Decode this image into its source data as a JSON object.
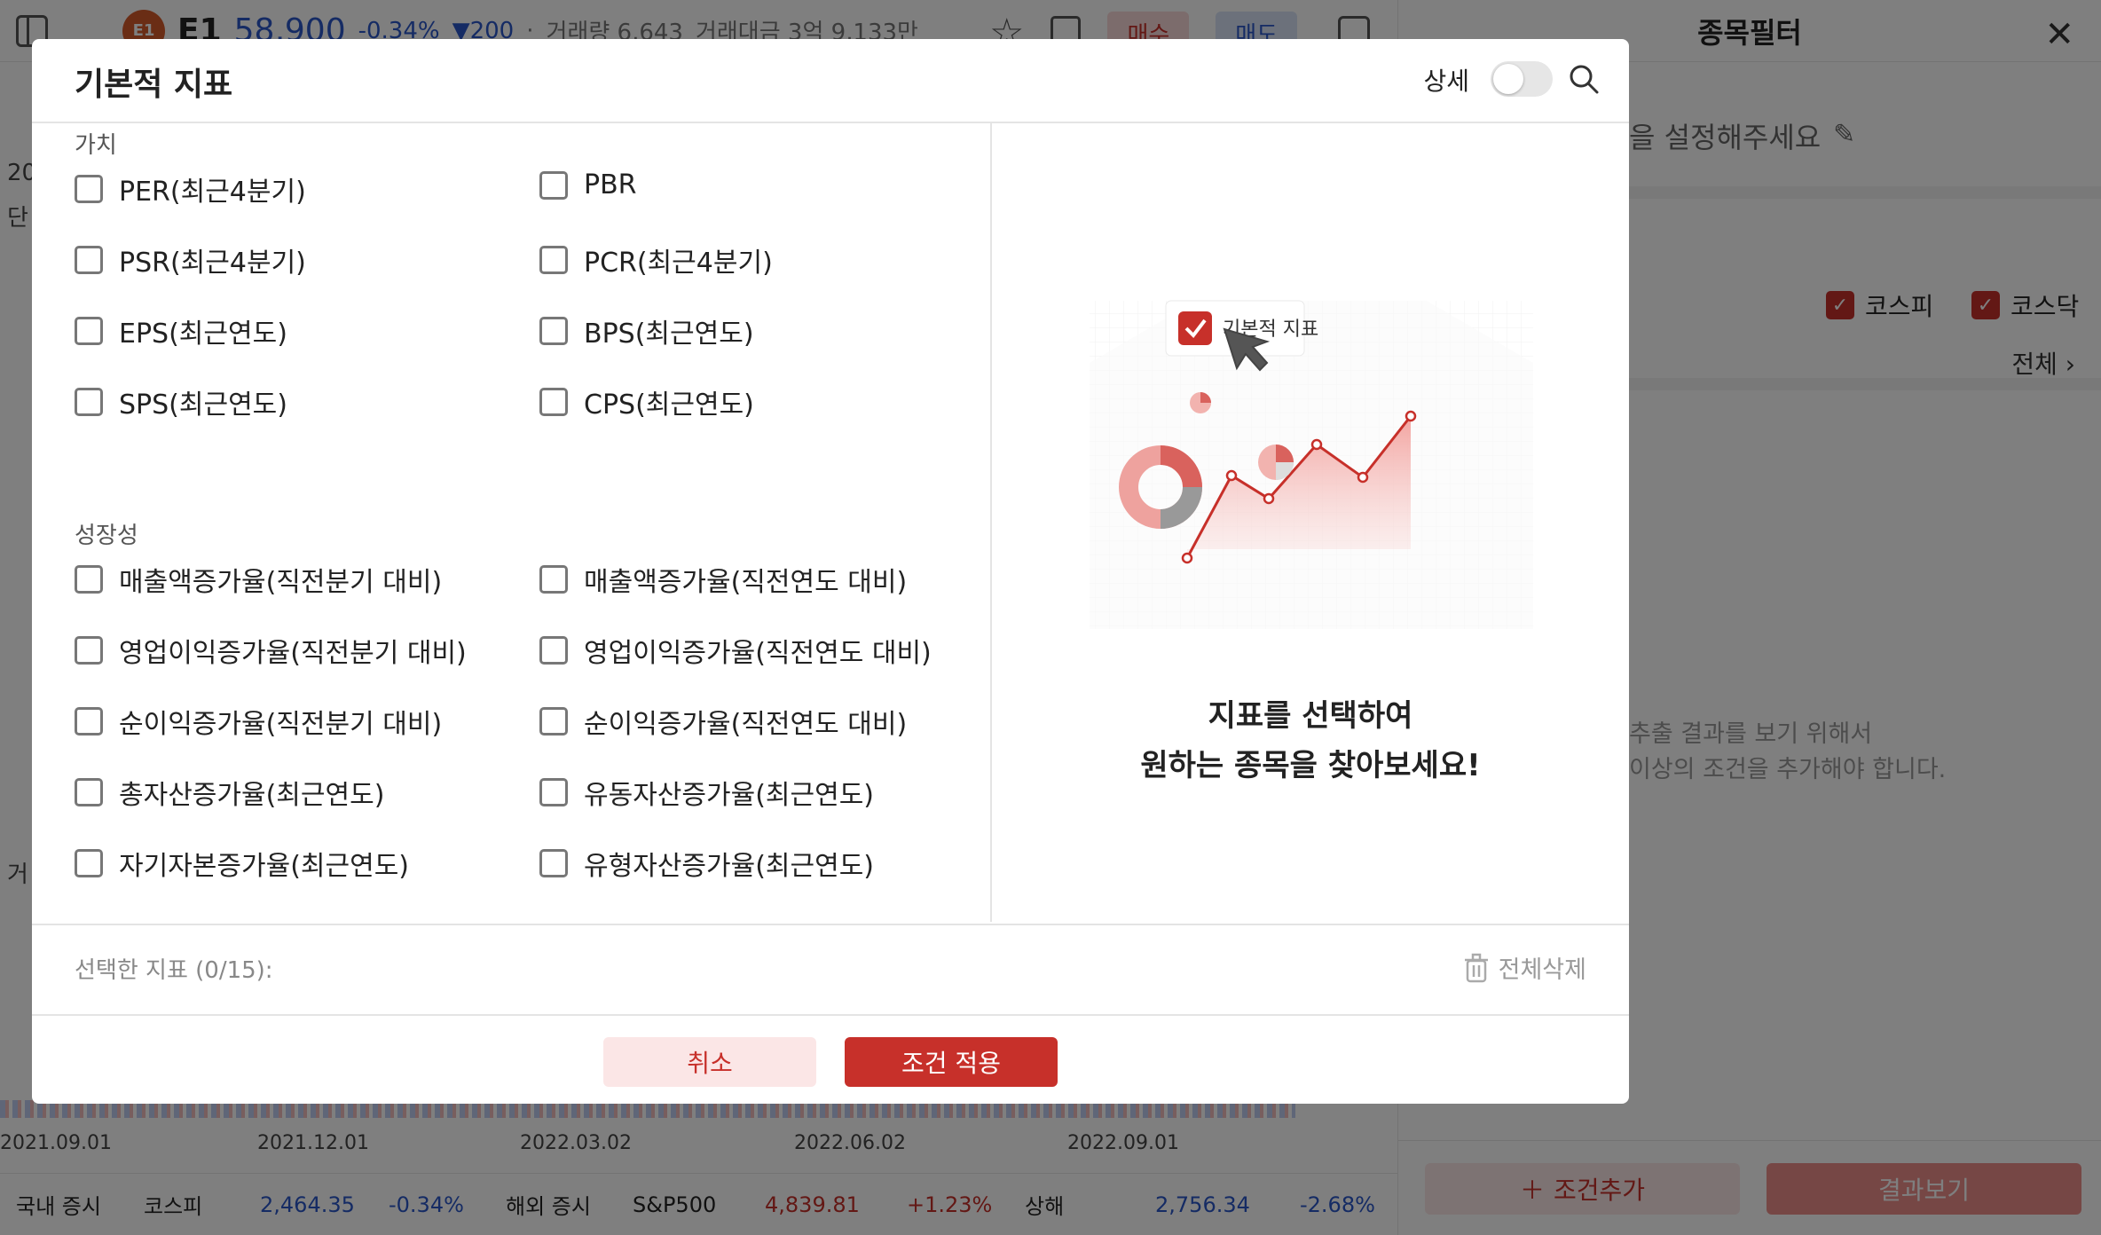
{
  "stock": {
    "logo_text": "E1",
    "symbol": "E1",
    "price": "58,900",
    "change_pct": "-0.34%",
    "change_abs": "▼200",
    "separator": "·",
    "volume": "거래량 6,643",
    "trade_value": "거래대금 3억 9,133만",
    "buy_label": "매수",
    "sell_label": "매도"
  },
  "chart": {
    "left_fragments": [
      "20",
      "단",
      "거"
    ],
    "dates": [
      "2021.09.01",
      "2021.12.01",
      "2022.03.02",
      "2022.06.02",
      "2022.09.01"
    ]
  },
  "ticker": {
    "domestic_label": "국내 증시",
    "kospi_name": "코스피",
    "kospi_value": "2,464.35",
    "kospi_change": "-0.34%",
    "overseas_label": "해외 증시",
    "sp_name": "S&P500",
    "sp_value": "4,839.81",
    "sp_change": "+1.23%",
    "sh_name": "상해",
    "sh_value": "2,756.34",
    "sh_change": "-2.68%"
  },
  "filter_panel": {
    "title": "종목필터",
    "name_prompt": "을 설정해주세요",
    "kospi_label": "코스피",
    "kosdaq_label": "코스닥",
    "all_label": "전체",
    "empty_line1": "추출 결과를 보기 위해서",
    "empty_line2": "이상의 조건을 추가해야 합니다.",
    "add_condition": "조건추가",
    "view_result": "결과보기"
  },
  "modal": {
    "title": "기본적 지표",
    "detail_label": "상세",
    "detail_toggle_on": false,
    "sections": [
      {
        "label": "가치",
        "items": [
          "PER(최근4분기)",
          "PBR",
          "PSR(최근4분기)",
          "PCR(최근4분기)",
          "EPS(최근연도)",
          "BPS(최근연도)",
          "SPS(최근연도)",
          "CPS(최근연도)"
        ]
      },
      {
        "label": "성장성",
        "items": [
          "매출액증가율(직전분기 대비)",
          "매출액증가율(직전연도 대비)",
          "영업이익증가율(직전분기 대비)",
          "영업이익증가율(직전연도 대비)",
          "순이익증가율(직전분기 대비)",
          "순이익증가율(직전연도 대비)",
          "총자산증가율(최근연도)",
          "유동자산증가율(최근연도)",
          "자기자본증가율(최근연도)",
          "유형자산증가율(최근연도)"
        ]
      }
    ],
    "illustration_badge": "기본적 지표",
    "promo_line1": "지표를 선택하여",
    "promo_line2": "원하는 종목을 찾아보세요!",
    "selected_label": "선택한 지표 (0/15):",
    "delete_all": "전체삭제",
    "cancel": "취소",
    "apply": "조건 적용"
  },
  "colors": {
    "accent": "#c7302a",
    "accent_light": "#fbe6e6",
    "blue": "#2a57c9"
  }
}
